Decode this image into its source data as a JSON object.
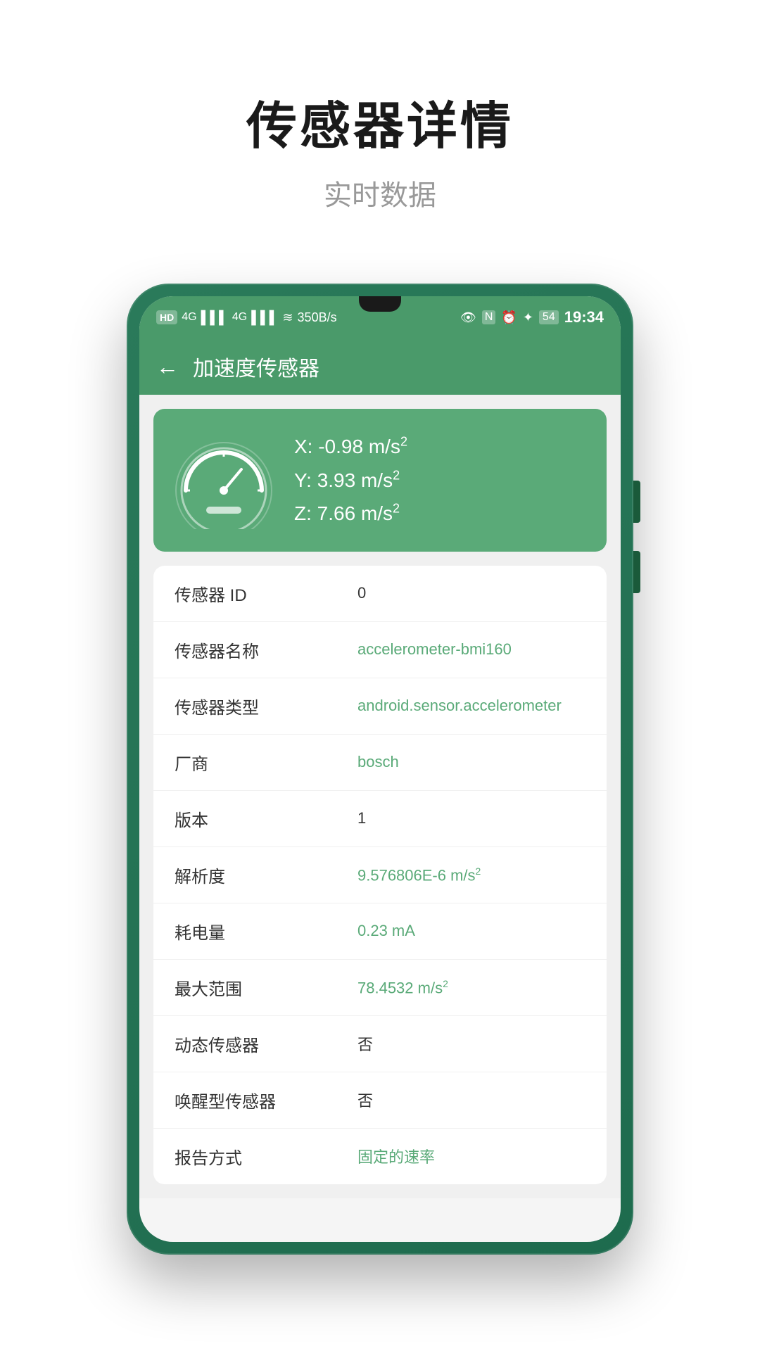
{
  "header": {
    "title": "传感器详情",
    "subtitle": "实时数据"
  },
  "status_bar": {
    "left": {
      "hd": "HD",
      "network1": "4G",
      "network2": "4G",
      "speed": "350B/s"
    },
    "right": {
      "time": "19:34",
      "battery": "54"
    }
  },
  "app_bar": {
    "back_label": "←",
    "title": "加速度传感器"
  },
  "sensor_card": {
    "x_label": "X: -0.98 m/s",
    "y_label": "Y: 3.93 m/s",
    "z_label": "Z: 7.66 m/s"
  },
  "details": [
    {
      "label": "传感器 ID",
      "value": "0",
      "green": false
    },
    {
      "label": "传感器名称",
      "value": "accelerometer-bmi160",
      "green": true
    },
    {
      "label": "传感器类型",
      "value": "android.sensor.accelerometer",
      "green": true
    },
    {
      "label": "厂商",
      "value": "bosch",
      "green": true
    },
    {
      "label": "版本",
      "value": "1",
      "green": false
    },
    {
      "label": "解析度",
      "value": "9.576806E-6 m/s²",
      "green": true
    },
    {
      "label": "耗电量",
      "value": "0.23  mA",
      "green": true
    },
    {
      "label": "最大范围",
      "value": "78.4532 m/s²",
      "green": true
    },
    {
      "label": "动态传感器",
      "value": "否",
      "green": false
    },
    {
      "label": "唤醒型传感器",
      "value": "否",
      "green": false
    },
    {
      "label": "报告方式",
      "value": "固定的速率",
      "green": true
    }
  ]
}
